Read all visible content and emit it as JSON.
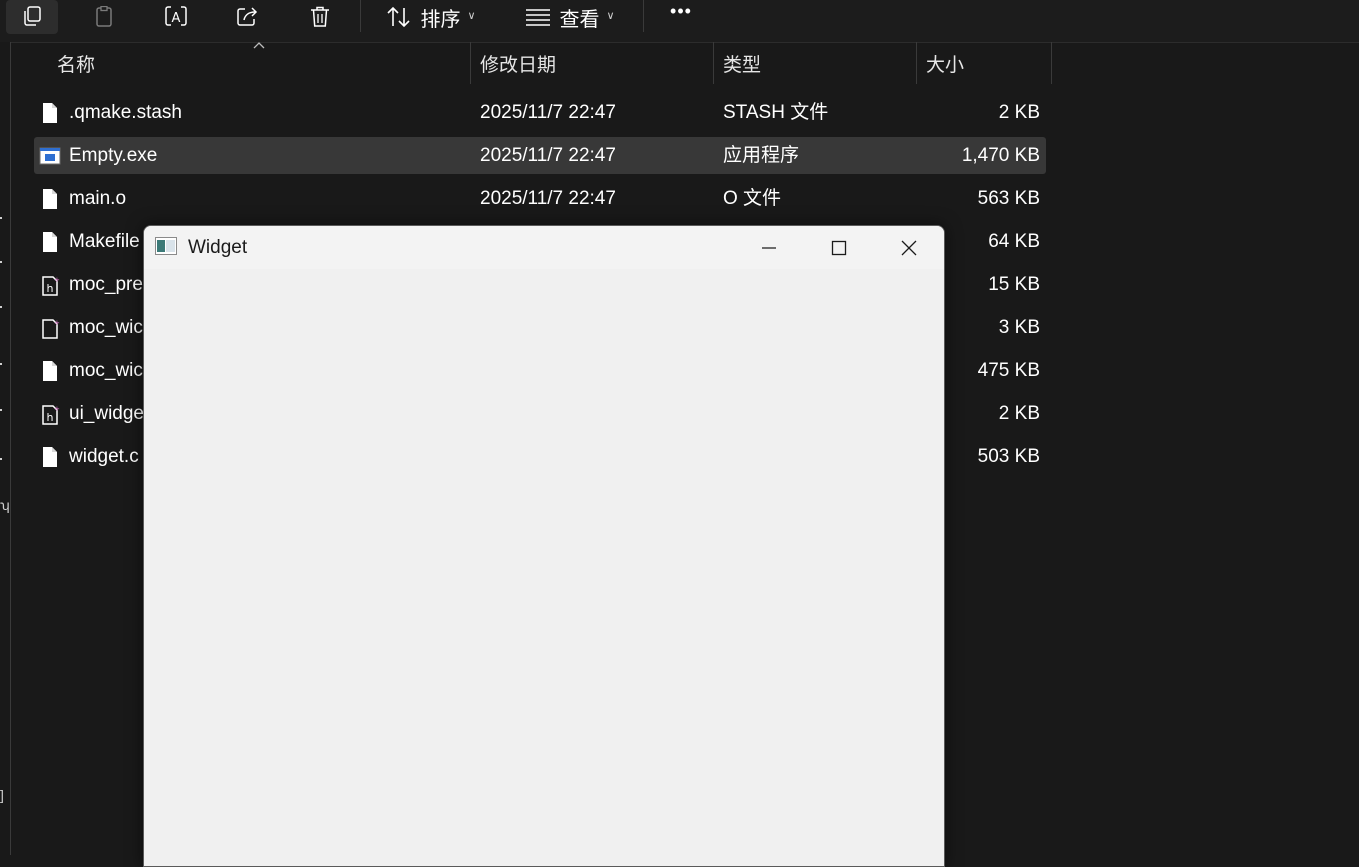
{
  "toolbar": {
    "sort_label": "排序",
    "view_label": "查看",
    "more_label": "•••"
  },
  "columns": {
    "name": "名称",
    "modified": "修改日期",
    "type": "类型",
    "size": "大小"
  },
  "files": [
    {
      "name": ".qmake.stash",
      "modified": "2025/11/7 22:47",
      "type": "STASH 文件",
      "size": "2 KB",
      "icon": "file-icon",
      "selected": false
    },
    {
      "name": "Empty.exe",
      "modified": "2025/11/7 22:47",
      "type": "应用程序",
      "size": "1,470 KB",
      "icon": "exe-icon",
      "selected": true
    },
    {
      "name": "main.o",
      "modified": "2025/11/7 22:47",
      "type": "O 文件",
      "size": "563 KB",
      "icon": "file-icon",
      "selected": false
    },
    {
      "name": "Makefile",
      "modified": "",
      "type": "",
      "size": "64 KB",
      "icon": "file-icon",
      "selected": false
    },
    {
      "name": "moc_pre",
      "modified": "",
      "type": "",
      "size": "15 KB",
      "icon": "cpp-header-icon",
      "selected": false
    },
    {
      "name": "moc_wic",
      "modified": "",
      "type": "",
      "size": "3 KB",
      "icon": "cpp-header-icon",
      "selected": false
    },
    {
      "name": "moc_wic",
      "modified": "",
      "type": "",
      "size": "475 KB",
      "icon": "file-icon",
      "selected": false
    },
    {
      "name": "ui_widge",
      "modified": "",
      "type": "",
      "size": "2 KB",
      "icon": "cpp-header-icon",
      "selected": false
    },
    {
      "name": "widget.c",
      "modified": "",
      "type": "",
      "size": "503 KB",
      "icon": "file-icon",
      "selected": false
    }
  ],
  "widget_window": {
    "title": "Widget"
  },
  "colors": {
    "explorer_background": "#191919",
    "selected_row": "#383838",
    "widget_background": "#f0f0f0"
  }
}
